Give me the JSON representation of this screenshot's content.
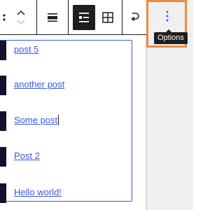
{
  "toolbar": {
    "buttons": [
      {
        "icon": "drag-handle-icon"
      },
      {
        "icon": "move-up-down-icon"
      },
      {
        "icon": "align-icon"
      },
      {
        "icon": "list-view-icon",
        "active": true
      },
      {
        "icon": "grid-view-icon"
      },
      {
        "icon": "convert-icon"
      }
    ],
    "options_icon": "vertical-ellipsis-icon",
    "options_tooltip": "Options"
  },
  "posts": [
    {
      "title": "post 5"
    },
    {
      "title": "another post"
    },
    {
      "title": "Some post",
      "has_caret": true
    },
    {
      "title": "Post 2"
    },
    {
      "title": "Hello world!"
    }
  ],
  "colors": {
    "link": "#3858e9",
    "selection_border": "#3858e9",
    "highlight": "#f08a3c",
    "toolbar_ink": "#1e1e1e",
    "sidebar_bg": "#f0f0f1"
  }
}
